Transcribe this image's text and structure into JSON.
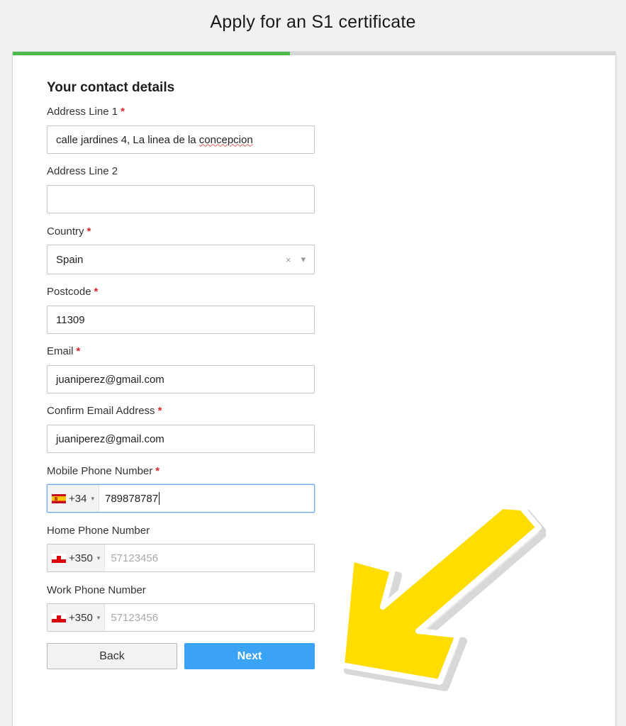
{
  "header": {
    "title": "Apply for an S1 certificate"
  },
  "progress": {
    "fraction": 0.46,
    "color": "#4cbb4c"
  },
  "section": {
    "title": "Your contact details"
  },
  "required_marker": "*",
  "fields": {
    "address1": {
      "label": "Address Line 1",
      "value": "calle jardines 4, La linea de la ",
      "value_misspelled": "concepcion"
    },
    "address2": {
      "label": "Address Line 2",
      "value": ""
    },
    "country": {
      "label": "Country",
      "value": "Spain",
      "clear_glyph": "×",
      "dropdown_glyph": "▾"
    },
    "postcode": {
      "label": "Postcode",
      "value": "11309"
    },
    "email": {
      "label": "Email",
      "value": "juaniperez@gmail.com"
    },
    "confirm_email": {
      "label": "Confirm Email Address",
      "value": "juaniperez@gmail.com"
    },
    "mobile": {
      "label": "Mobile Phone Number",
      "flag": "spain-flag-icon",
      "code": "+34",
      "value": "789878787"
    },
    "home": {
      "label": "Home Phone Number",
      "flag": "gibraltar-flag-icon",
      "code": "+350",
      "placeholder": "57123456"
    },
    "work": {
      "label": "Work Phone Number",
      "flag": "gibraltar-flag-icon",
      "code": "+350",
      "placeholder": "57123456"
    }
  },
  "buttons": {
    "back": "Back",
    "next": "Next"
  },
  "colors": {
    "accent": "#3ba3f3",
    "required": "#d6262c",
    "arrow": "#ffdd00"
  },
  "annotation": {
    "icon": "arrow-pointer-icon"
  }
}
